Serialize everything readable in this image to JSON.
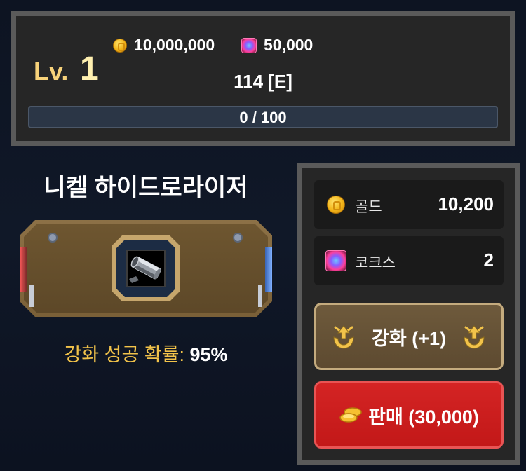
{
  "player": {
    "level_label": "Lv.",
    "level_value": "1",
    "gold_amount": "10,000,000",
    "cocos_amount": "50,000",
    "level_code": "114 [E]",
    "xp_text": "0 / 100",
    "xp_progress": 0
  },
  "item": {
    "name": "니켈 하이드로라이저",
    "icon": "nickel-hydrolyzer-tube-icon",
    "success_chance_label": "강화 성공 확률:",
    "success_chance_value": "95%"
  },
  "cost": {
    "gold_label": "골드",
    "gold_value": "10,200",
    "cocos_label": "코크스",
    "cocos_value": "2"
  },
  "actions": {
    "enhance_label": "강화 (+1)",
    "sell_label": "판매 (30,000)"
  },
  "colors": {
    "gold_text": "#f2c34a",
    "level_label": "#f7d27a",
    "sell_red": "#d42424",
    "enhance_brown": "#6e5a3c"
  }
}
